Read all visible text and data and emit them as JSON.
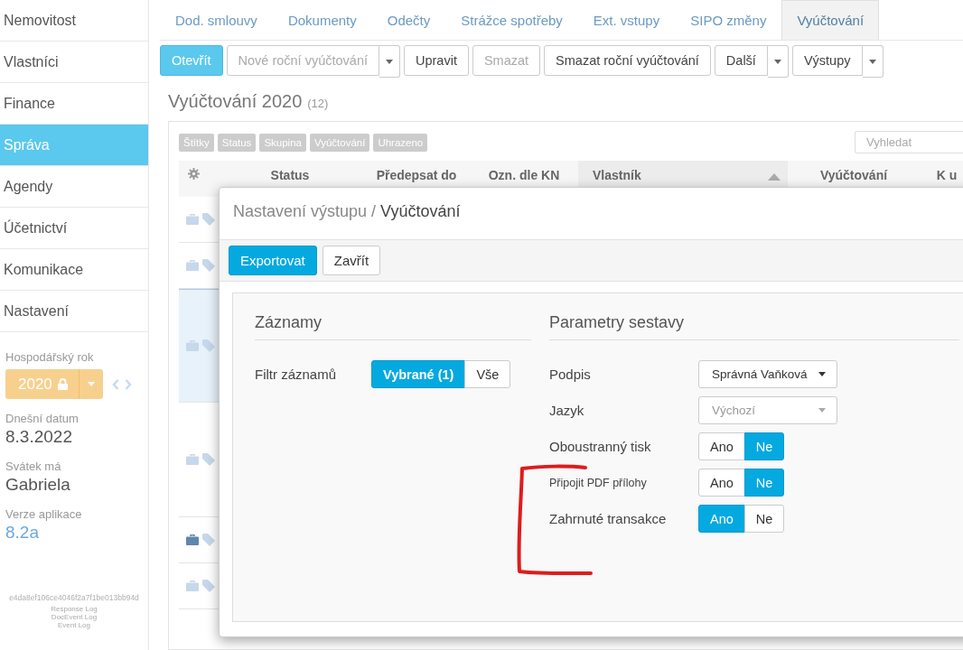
{
  "sidebar": {
    "items": [
      {
        "label": "Nemovitost",
        "selected": false
      },
      {
        "label": "Vlastníci",
        "selected": false
      },
      {
        "label": "Finance",
        "selected": false
      },
      {
        "label": "Správa",
        "selected": true
      },
      {
        "label": "Agendy",
        "selected": false
      },
      {
        "label": "Účetnictví",
        "selected": false
      },
      {
        "label": "Komunikace",
        "selected": false
      },
      {
        "label": "Nastavení",
        "selected": false
      }
    ],
    "fiscal_year": {
      "label": "Hospodářský rok",
      "value": "2020",
      "locked": true
    },
    "info": [
      {
        "label": "Dnešní datum",
        "value": "8.3.2022",
        "kind": "plain"
      },
      {
        "label": "Svátek má",
        "value": "Gabriela",
        "kind": "plain"
      },
      {
        "label": "Verze aplikace",
        "value": "8.2a",
        "kind": "link"
      }
    ],
    "build_hash": "e4da8ef106ce4046f2a7f1be013bb94d",
    "log_links": [
      "Response Log",
      "DocEvent Log",
      "Event Log"
    ]
  },
  "tabs": [
    {
      "label": "Dod. smlouvy",
      "selected": false
    },
    {
      "label": "Dokumenty",
      "selected": false
    },
    {
      "label": "Odečty",
      "selected": false
    },
    {
      "label": "Strážce spotřeby",
      "selected": false
    },
    {
      "label": "Ext. vstupy",
      "selected": false
    },
    {
      "label": "SIPO změny",
      "selected": false
    },
    {
      "label": "Vyúčtování",
      "selected": true
    }
  ],
  "toolbar": [
    {
      "label": "Otevřít",
      "kind": "primary",
      "disabled": false,
      "dropdown": false
    },
    {
      "label": "Nové roční vyúčtování",
      "kind": "default",
      "disabled": true,
      "dropdown": true
    },
    {
      "label": "Upravit",
      "kind": "default",
      "disabled": false,
      "dropdown": false
    },
    {
      "label": "Smazat",
      "kind": "default",
      "disabled": true,
      "dropdown": false
    },
    {
      "label": "Smazat roční vyúčtování",
      "kind": "default",
      "disabled": false,
      "dropdown": false
    },
    {
      "label": "Další",
      "kind": "default",
      "disabled": false,
      "dropdown": true
    },
    {
      "label": "Výstupy",
      "kind": "default",
      "disabled": false,
      "dropdown": true
    }
  ],
  "heading": {
    "title": "Vyúčtování 2020",
    "count": "(12)"
  },
  "filter_chips": [
    "Štítky",
    "Status",
    "Skupina",
    "Vyúčtování",
    "Uhrazeno"
  ],
  "search": {
    "placeholder": "Vyhledat"
  },
  "table": {
    "columns": [
      {
        "label": "Status",
        "sorted": false
      },
      {
        "label": "Předepsat do",
        "sorted": false
      },
      {
        "label": "Ozn. dle KN",
        "sorted": false
      },
      {
        "label": "Vlastník",
        "sorted": true
      },
      {
        "label": "Vyúčtování",
        "sorted": false
      },
      {
        "label": "K u",
        "sorted": false
      }
    ],
    "rows": [
      {
        "selected": false,
        "marked": false
      },
      {
        "selected": false,
        "marked": false
      },
      {
        "selected": true,
        "marked": false
      },
      {
        "selected": false,
        "marked": false
      },
      {
        "selected": false,
        "marked": true
      },
      {
        "selected": false,
        "marked": false
      }
    ]
  },
  "dialog": {
    "path": "Nastavení výstupu /",
    "title": "Vyúčtování",
    "buttons": [
      {
        "label": "Exportovat",
        "kind": "primary"
      },
      {
        "label": "Zavřít",
        "kind": "default"
      }
    ],
    "sections": [
      {
        "title": "Záznamy",
        "fields": [
          {
            "label": "Filtr záznamů",
            "kind": "toggle",
            "small_label": false,
            "options": [
              {
                "label": "Vybrané (1)",
                "selected": true
              },
              {
                "label": "Vše",
                "selected": false
              }
            ]
          }
        ]
      },
      {
        "title": "Parametry sestavy",
        "fields": [
          {
            "label": "Podpis",
            "kind": "select",
            "value": "Správná Vaňková"
          },
          {
            "label": "Jazyk",
            "kind": "select",
            "placeholder": "Výchozí"
          },
          {
            "label": "Oboustranný tisk",
            "kind": "toggle",
            "small_label": false,
            "options": [
              {
                "label": "Ano",
                "selected": false
              },
              {
                "label": "Ne",
                "selected": true
              }
            ]
          },
          {
            "label": "Připojit PDF přílohy",
            "kind": "toggle",
            "small_label": true,
            "options": [
              {
                "label": "Ano",
                "selected": false
              },
              {
                "label": "Ne",
                "selected": true
              }
            ]
          },
          {
            "label": "Zahrnuté transakce",
            "kind": "toggle",
            "small_label": false,
            "options": [
              {
                "label": "Ano",
                "selected": true
              },
              {
                "label": "Ne",
                "selected": false
              }
            ]
          }
        ]
      }
    ]
  }
}
